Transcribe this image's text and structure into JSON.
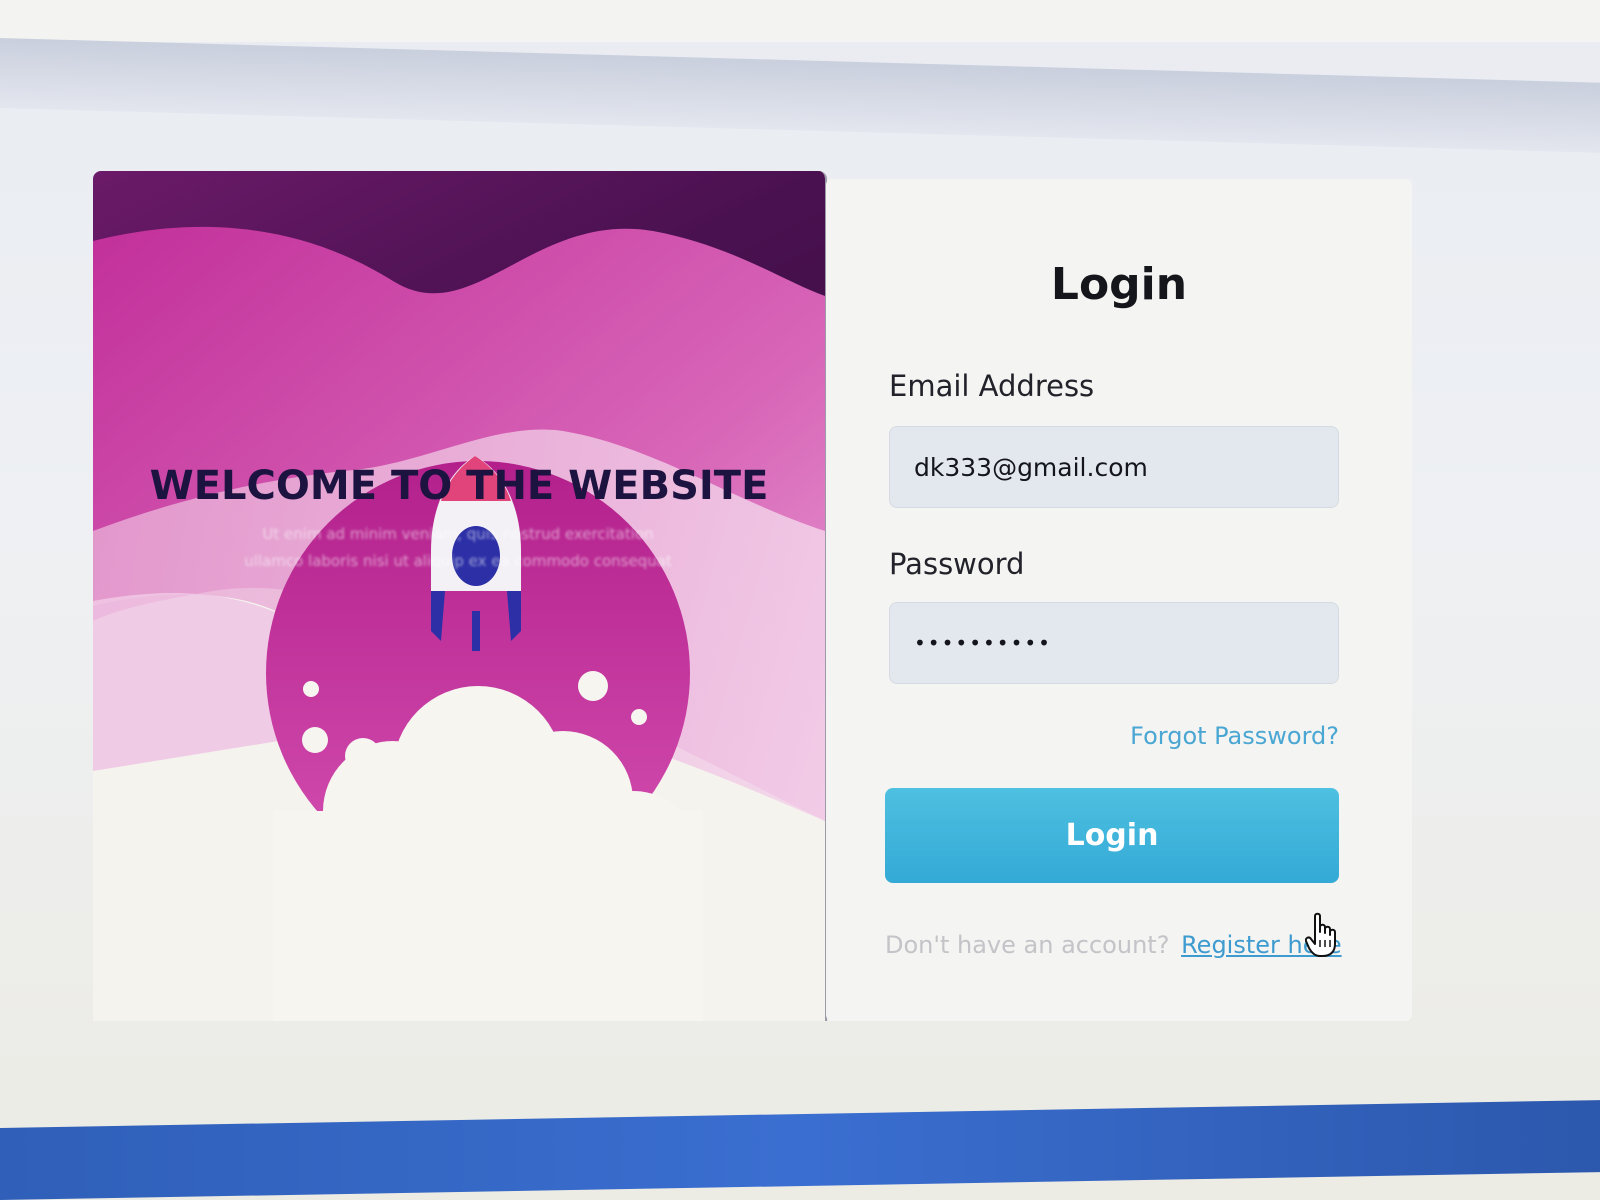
{
  "hero": {
    "title": "WELCOME TO THE WEBSITE",
    "subtitle": "Ut enim ad minim veniam, quis nostrud exercitation ullamco laboris nisi ut aliquip ex ea commodo consequat",
    "illustration": "rocket-launch-illustration"
  },
  "login": {
    "title": "Login",
    "email_label": "Email Address",
    "email_value": "dk333@gmail.com",
    "password_label": "Password",
    "password_value": "••••••••••",
    "forgot_link": "Forgot Password?",
    "submit_label": "Login",
    "register_prompt": "Don't have an account?",
    "register_link": "Register here"
  },
  "cursor": "hand-pointer-icon",
  "colors": {
    "accent": "#33a9d6",
    "link": "#4aa6d2",
    "hero_magenta": "#c2309a",
    "hero_dark_purple": "#4a1150",
    "bottom_bar": "#3a6ed0"
  }
}
